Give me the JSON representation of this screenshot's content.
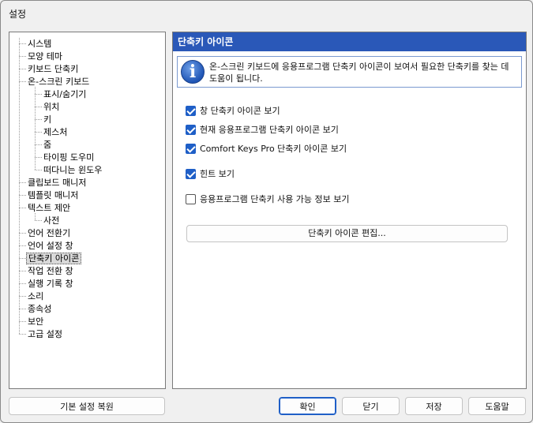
{
  "window": {
    "title": "설정"
  },
  "tree": {
    "items": [
      {
        "label": "시스템",
        "level": 0,
        "selected": false
      },
      {
        "label": "모양 테마",
        "level": 0,
        "selected": false
      },
      {
        "label": "키보드 단축키",
        "level": 0,
        "selected": false
      },
      {
        "label": "온-스크린 키보드",
        "level": 0,
        "selected": false
      },
      {
        "label": "표시/숨기기",
        "level": 1,
        "selected": false
      },
      {
        "label": "위치",
        "level": 1,
        "selected": false
      },
      {
        "label": "키",
        "level": 1,
        "selected": false
      },
      {
        "label": "제스처",
        "level": 1,
        "selected": false
      },
      {
        "label": "줌",
        "level": 1,
        "selected": false
      },
      {
        "label": "타이핑 도우미",
        "level": 1,
        "selected": false
      },
      {
        "label": "떠다니는 윈도우",
        "level": 1,
        "selected": false
      },
      {
        "label": "클립보드 매니저",
        "level": 0,
        "selected": false
      },
      {
        "label": "템플릿 매니저",
        "level": 0,
        "selected": false
      },
      {
        "label": "텍스트 제안",
        "level": 0,
        "selected": false
      },
      {
        "label": "사전",
        "level": 1,
        "selected": false
      },
      {
        "label": "언어 전환기",
        "level": 0,
        "selected": false
      },
      {
        "label": "언어 설정 창",
        "level": 0,
        "selected": false
      },
      {
        "label": "단축키 아이콘",
        "level": 0,
        "selected": true
      },
      {
        "label": "작업 전환 창",
        "level": 0,
        "selected": false
      },
      {
        "label": "실행 기록 창",
        "level": 0,
        "selected": false
      },
      {
        "label": "소리",
        "level": 0,
        "selected": false
      },
      {
        "label": "종속성",
        "level": 0,
        "selected": false
      },
      {
        "label": "보안",
        "level": 0,
        "selected": false
      },
      {
        "label": "고급 설정",
        "level": 0,
        "selected": false
      }
    ]
  },
  "panel": {
    "header": "단축키 아이콘",
    "info_icon": "info-icon",
    "info_glyph": "i",
    "info_text": "온-스크린 키보드에 응용프로그램 단축키 아이콘이 보여서 필요한 단축키를 찾는 데 도움이 됩니다.",
    "options": [
      {
        "label": "창 단축키 아이콘 보기",
        "checked": true
      },
      {
        "label": "현재 응용프로그램 단축키 아이콘 보기",
        "checked": true
      },
      {
        "label": "Comfort Keys Pro 단축키 아이콘 보기",
        "checked": true
      },
      {
        "label": "힌트 보기",
        "checked": true
      },
      {
        "label": "응용프로그램 단축키 사용 가능 정보 보기",
        "checked": false
      }
    ],
    "edit_button": "단축키 아이콘 편집..."
  },
  "footer": {
    "reset": "기본 설정 복원",
    "ok": "확인",
    "close": "닫기",
    "save": "저장",
    "help": "도움말"
  },
  "colors": {
    "accent": "#1f5fc7",
    "header": "#2a58b8"
  }
}
